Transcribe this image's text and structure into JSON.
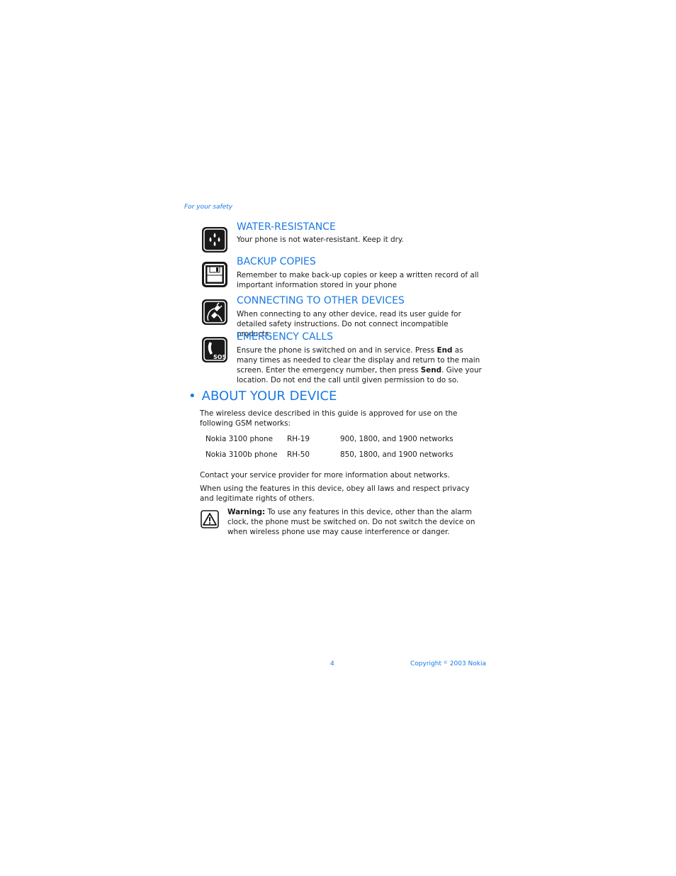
{
  "running_head": "For your safety",
  "safety_sections": [
    {
      "icon": "water-drops-icon",
      "title": "WATER-RESISTANCE",
      "text": "Your phone is not water-resistant. Keep it dry."
    },
    {
      "icon": "floppy-disk-icon",
      "title": "BACKUP COPIES",
      "text": "Remember to make back-up copies or keep a written record of all important information stored in your phone"
    },
    {
      "icon": "plug-connector-icon",
      "title": "CONNECTING TO OTHER DEVICES",
      "text": "When connecting to any other device, read its user guide for detailed safety instructions. Do not connect incompatible products."
    },
    {
      "icon": "sos-phone-icon",
      "title": "EMERGENCY CALLS",
      "text_parts": [
        "Ensure the phone is switched on and in service. Press ",
        "End",
        " as many times as needed to clear the display and return to the main screen. Enter the emergency number, then press ",
        "Send",
        ". Give your location. Do not end the call until given permission to do so."
      ]
    }
  ],
  "about": {
    "bullet": "•",
    "title": "ABOUT YOUR DEVICE",
    "intro": "The wireless device described in this guide is approved for use on the following GSM networks:",
    "networks": [
      {
        "model": "Nokia 3100 phone",
        "type": "RH-19",
        "bands": "900, 1800, and 1900 networks"
      },
      {
        "model": "Nokia 3100b phone",
        "type": "RH-50",
        "bands": "850, 1800, and 1900 networks"
      }
    ],
    "contact_text": "Contact your service provider for more information about networks.",
    "laws_text": "When using the features in this device, obey all laws and respect privacy and legitimate rights of others.",
    "warning": {
      "icon": "warning-triangle-icon",
      "label": "Warning:",
      "text": " To use any features in this device, other than the alarm clock, the phone must be switched on. Do not switch the device on when wireless phone use may cause interference or danger."
    }
  },
  "footer": {
    "page_number": "4",
    "copyright_prefix": "Copyright",
    "copyright_symbol": "©",
    "copyright_suffix": "2003 Nokia"
  },
  "colors": {
    "accent": "#1a7ae6",
    "text": "#1a1a1a"
  }
}
